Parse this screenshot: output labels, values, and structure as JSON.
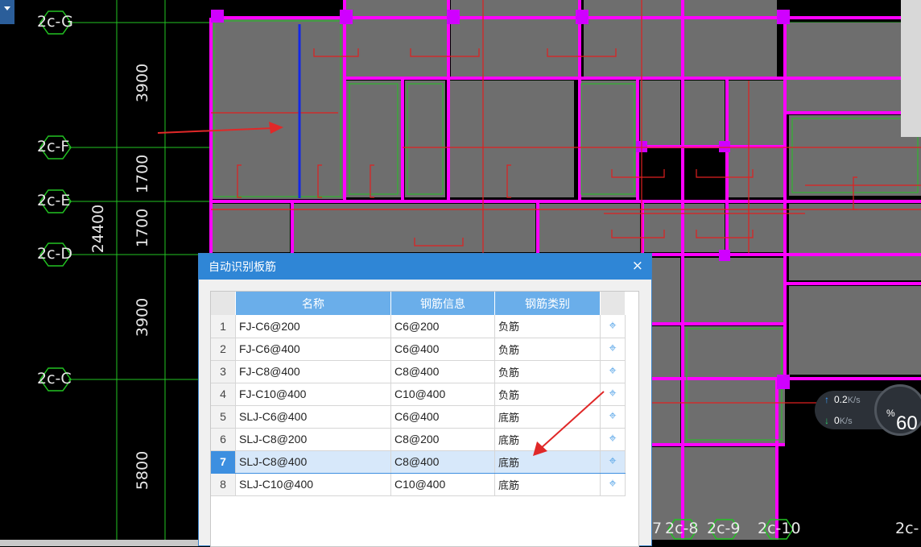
{
  "axes": {
    "rows": [
      {
        "label": "2c-G"
      },
      {
        "label": "2c-F"
      },
      {
        "label": "2c-E"
      },
      {
        "label": "2c-D"
      },
      {
        "label": "2c-C"
      }
    ],
    "dimensions": [
      "3900",
      "1700",
      "1700",
      "3900",
      "5800"
    ],
    "total_dimension": "24400",
    "bottom_labels": [
      "7",
      "2c-8",
      "2c-9",
      "2c-10",
      "2c-"
    ]
  },
  "dialog": {
    "title": "自动识别板筋",
    "close_label": "×",
    "columns": [
      "名称",
      "钢筋信息",
      "钢筋类别"
    ],
    "rows": [
      {
        "idx": "1",
        "name": "FJ-C6@200",
        "info": "C6@200",
        "category": "负筋"
      },
      {
        "idx": "2",
        "name": "FJ-C6@400",
        "info": "C6@400",
        "category": "负筋"
      },
      {
        "idx": "3",
        "name": "FJ-C8@400",
        "info": "C8@400",
        "category": "负筋"
      },
      {
        "idx": "4",
        "name": "FJ-C10@400",
        "info": "C10@400",
        "category": "负筋"
      },
      {
        "idx": "5",
        "name": "SLJ-C6@400",
        "info": "C6@400",
        "category": "底筋"
      },
      {
        "idx": "6",
        "name": "SLJ-C8@200",
        "info": "C8@200",
        "category": "底筋"
      },
      {
        "idx": "7",
        "name": "SLJ-C8@400",
        "info": "C8@400",
        "category": "底筋"
      },
      {
        "idx": "8",
        "name": "SLJ-C10@400",
        "info": "C10@400",
        "category": "底筋"
      }
    ],
    "selected_row": 7,
    "locate_icon": "crosshair-icon"
  },
  "net_monitor": {
    "upload": "0.2",
    "download": "0",
    "unit": "K/s",
    "percent": "60",
    "percent_sign": "%"
  },
  "colors": {
    "background": "#000000",
    "slab_fill": "#6e6e6e",
    "beam": "#ff00ff",
    "grid": "#22c322",
    "rebar": "#e02020",
    "annotation_arrow": "#e02828",
    "selected_rebar": "#1428e6",
    "dialog_title": "#2f86d6",
    "header": "#6aaeea"
  }
}
